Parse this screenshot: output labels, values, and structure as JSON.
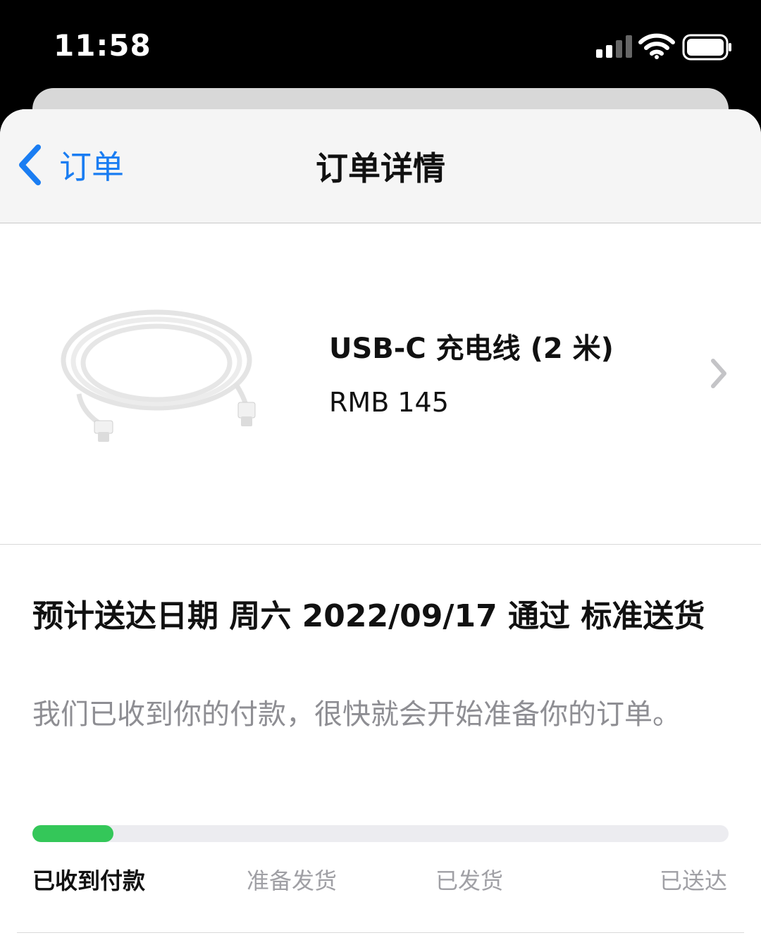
{
  "status_bar": {
    "time": "11:58",
    "icons": [
      "cellular-signal-icon",
      "wifi-icon",
      "battery-icon"
    ]
  },
  "nav": {
    "back_label": "订单",
    "title": "订单详情"
  },
  "product": {
    "name": "USB-C 充电线 (2 米)",
    "price": "RMB 145"
  },
  "delivery": {
    "title": "预计送达日期 周六 2022/09/17 通过 标准送货",
    "description": "我们已收到你的付款，很快就会开始准备你的订单。",
    "progress": 0.116,
    "steps": [
      "已收到付款",
      "准备发货",
      "已发货",
      "已送达"
    ],
    "active_step": 0
  },
  "colors": {
    "accent": "#1a7df2",
    "progress": "#34c759",
    "secondary_text": "#8e8e93"
  }
}
